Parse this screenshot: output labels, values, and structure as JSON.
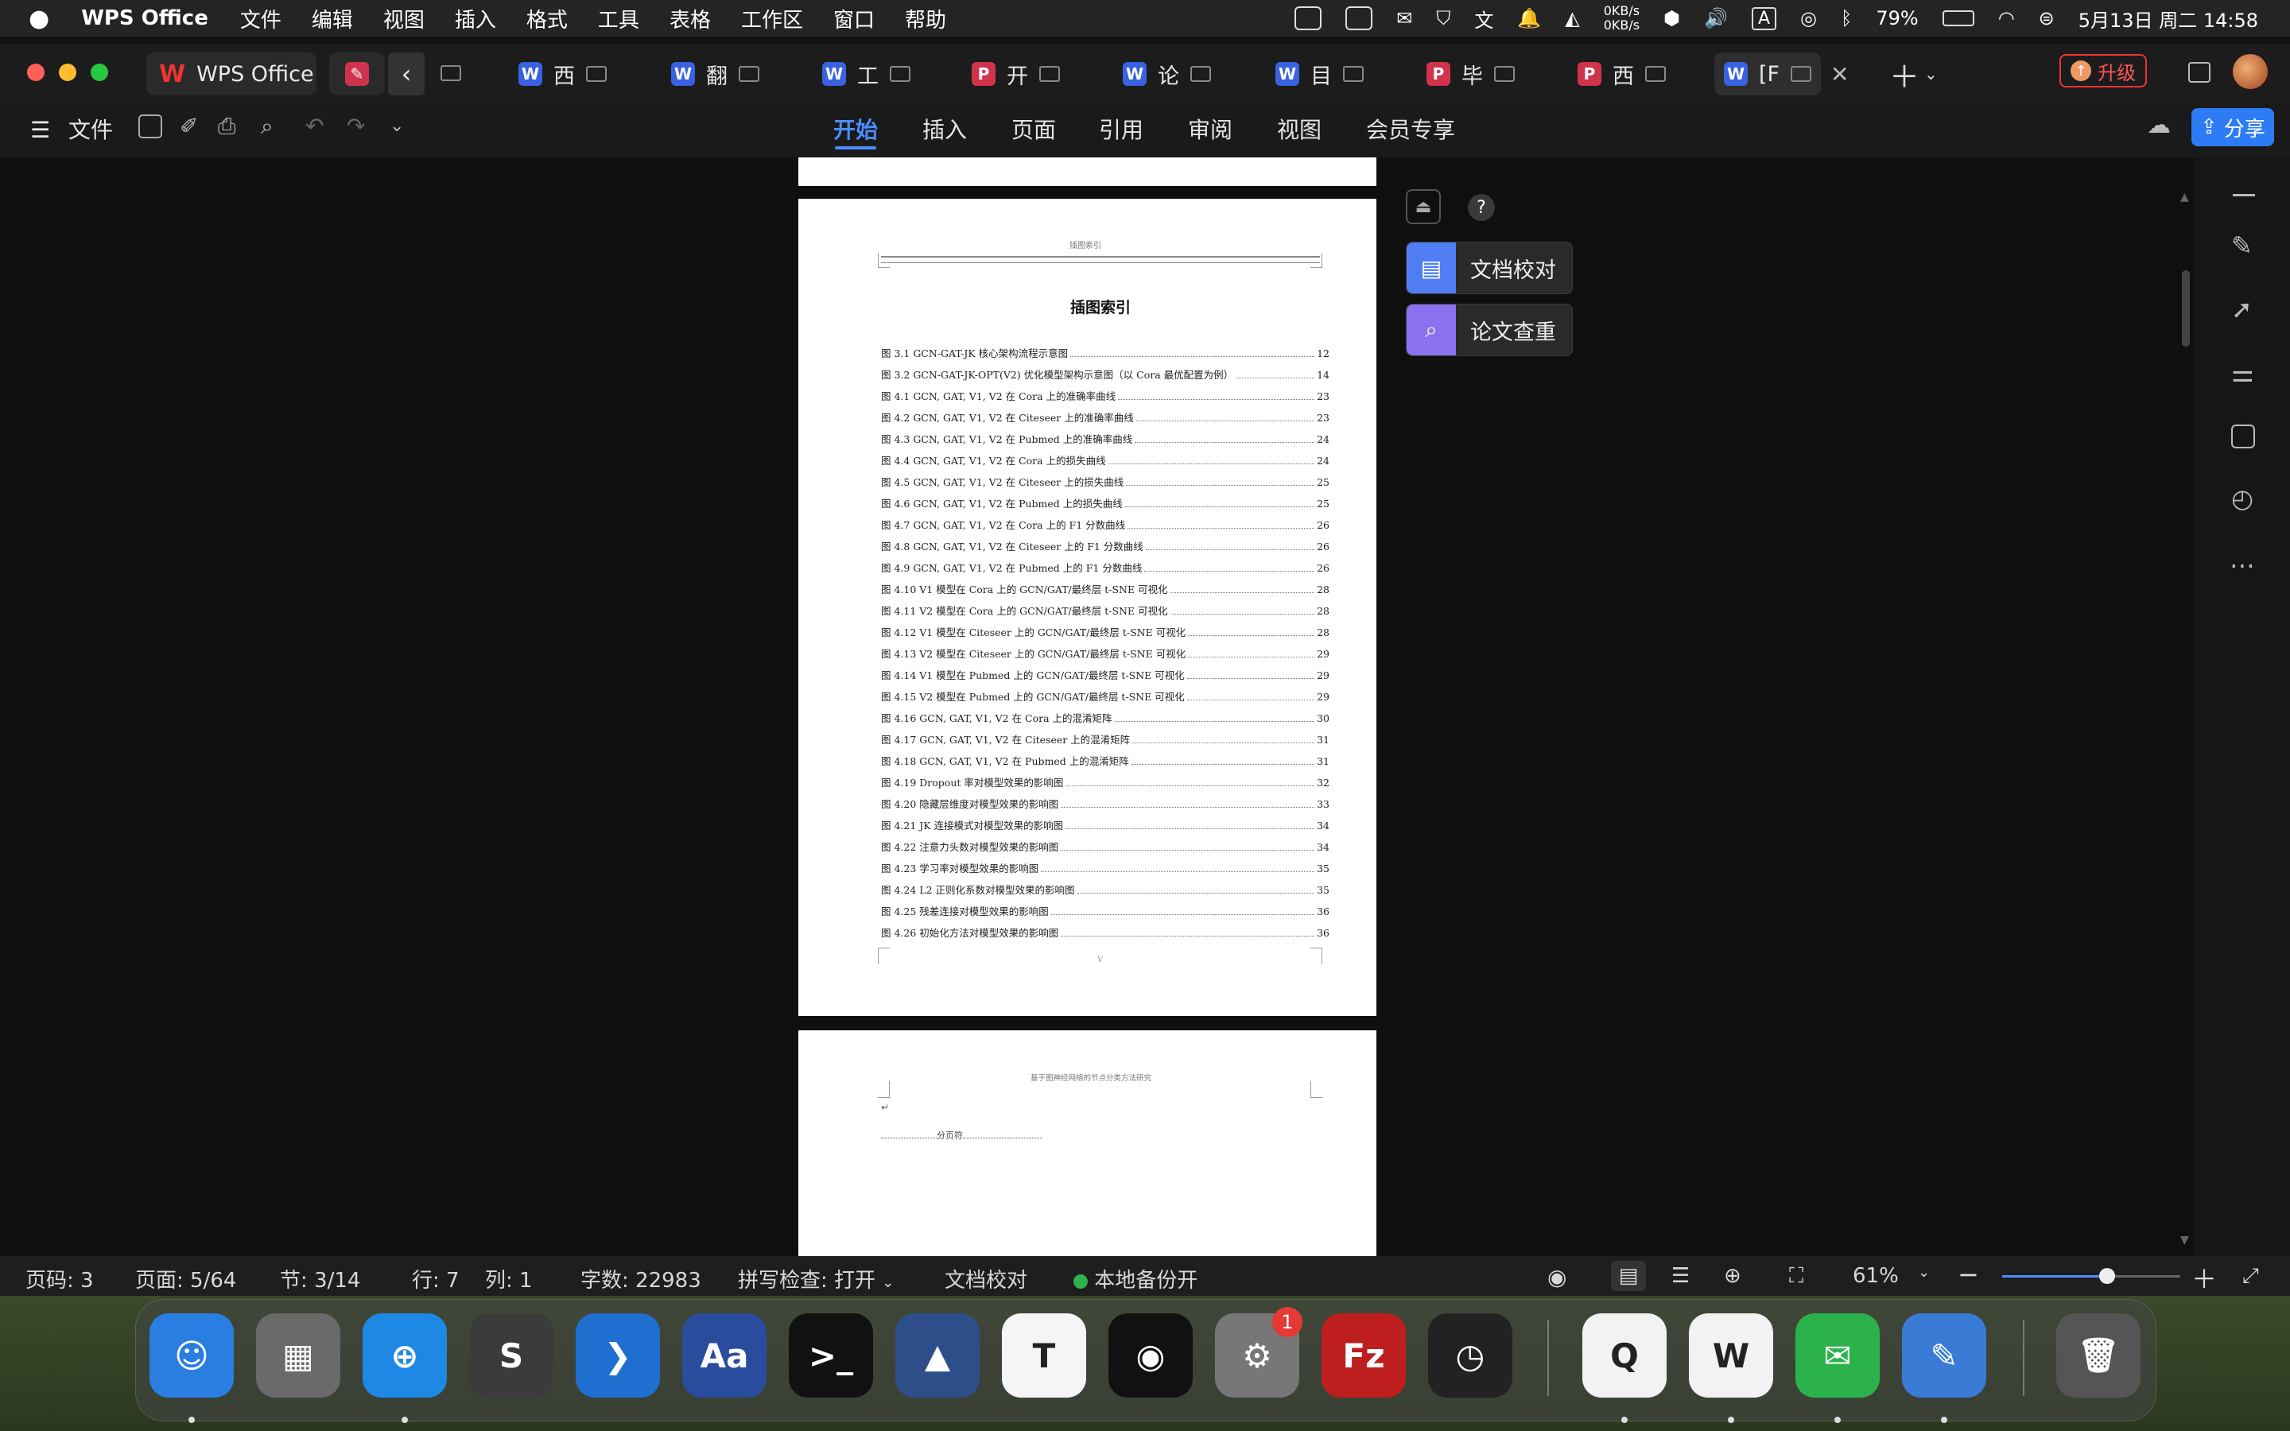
{
  "menubar": {
    "app": "WPS Office",
    "items": [
      "文件",
      "编辑",
      "视图",
      "插入",
      "格式",
      "工具",
      "表格",
      "工作区",
      "窗口",
      "帮助"
    ],
    "net_up": "0KB/s",
    "net_down": "0KB/s",
    "input_method": "A",
    "battery": "79%",
    "datetime": "5月13日 周二  14:58"
  },
  "tabs": {
    "home": "WPS Office",
    "docs": [
      {
        "label": "西",
        "icon": "W",
        "color": "#3a62e0"
      },
      {
        "label": "翻",
        "icon": "W",
        "color": "#3a62e0"
      },
      {
        "label": "工",
        "icon": "W",
        "color": "#3a62e0"
      },
      {
        "label": "开",
        "icon": "P",
        "color": "#d0344c"
      },
      {
        "label": "论",
        "icon": "W",
        "color": "#3a62e0"
      },
      {
        "label": "目",
        "icon": "W",
        "color": "#3a62e0"
      },
      {
        "label": "毕",
        "icon": "P",
        "color": "#d0344c"
      },
      {
        "label": "西",
        "icon": "P",
        "color": "#d0344c"
      },
      {
        "label": "[F",
        "icon": "W",
        "color": "#3a62e0"
      }
    ],
    "upgrade": "升级"
  },
  "toolbar": {
    "file": "文件",
    "nav": [
      "开始",
      "插入",
      "页面",
      "引用",
      "审阅",
      "视图",
      "会员专享"
    ],
    "share": "分享"
  },
  "panel": {
    "proofread": "文档校对",
    "plagiarism": "论文查重",
    "help": "?"
  },
  "doc": {
    "header_page1": "插图索引",
    "title": "插图索引",
    "footer_page": "V",
    "header_page2": "基于图神经网络的节点分类方法研究",
    "section_break": "分页符",
    "toc": [
      {
        "label": "图 3.1   GCN-GAT-JK 核心架构流程示意图",
        "page": "12"
      },
      {
        "label": "图 3.2   GCN-GAT-JK-OPT(V2) 优化模型架构示意图（以 Cora 最优配置为例）",
        "page": "14"
      },
      {
        "label": "图 4.1   GCN, GAT, V1, V2 在 Cora 上的准确率曲线",
        "page": "23"
      },
      {
        "label": "图 4.2   GCN, GAT, V1, V2 在 Citeseer 上的准确率曲线",
        "page": "23"
      },
      {
        "label": "图 4.3   GCN, GAT, V1, V2 在 Pubmed 上的准确率曲线",
        "page": "24"
      },
      {
        "label": "图 4.4   GCN, GAT, V1, V2 在 Cora 上的损失曲线",
        "page": "24"
      },
      {
        "label": "图 4.5   GCN, GAT, V1, V2 在 Citeseer 上的损失曲线",
        "page": "25"
      },
      {
        "label": "图 4.6   GCN, GAT, V1, V2 在 Pubmed 上的损失曲线",
        "page": "25"
      },
      {
        "label": "图 4.7   GCN, GAT, V1, V2 在 Cora 上的 F1 分数曲线",
        "page": "26"
      },
      {
        "label": "图 4.8   GCN, GAT, V1, V2 在 Citeseer 上的 F1 分数曲线",
        "page": "26"
      },
      {
        "label": "图 4.9   GCN, GAT, V1, V2 在 Pubmed 上的 F1 分数曲线",
        "page": "26"
      },
      {
        "label": "图 4.10  V1 模型在 Cora 上的 GCN/GAT/最终层 t-SNE 可视化",
        "page": "28"
      },
      {
        "label": "图 4.11  V2 模型在 Cora 上的 GCN/GAT/最终层 t-SNE 可视化",
        "page": "28"
      },
      {
        "label": "图 4.12  V1 模型在 Citeseer 上的 GCN/GAT/最终层 t-SNE 可视化",
        "page": "28"
      },
      {
        "label": "图 4.13  V2 模型在 Citeseer 上的 GCN/GAT/最终层 t-SNE 可视化",
        "page": "29"
      },
      {
        "label": "图 4.14  V1 模型在 Pubmed 上的 GCN/GAT/最终层 t-SNE 可视化",
        "page": "29"
      },
      {
        "label": "图 4.15  V2 模型在 Pubmed 上的 GCN/GAT/最终层 t-SNE 可视化",
        "page": "29"
      },
      {
        "label": "图 4.16  GCN, GAT, V1, V2 在 Cora 上的混淆矩阵",
        "page": "30"
      },
      {
        "label": "图 4.17  GCN, GAT, V1, V2 在 Citeseer 上的混淆矩阵",
        "page": "31"
      },
      {
        "label": "图 4.18  GCN, GAT, V1, V2 在 Pubmed 上的混淆矩阵",
        "page": "31"
      },
      {
        "label": "图 4.19  Dropout 率对模型效果的影响图",
        "page": "32"
      },
      {
        "label": "图 4.20  隐藏层维度对模型效果的影响图",
        "page": "33"
      },
      {
        "label": "图 4.21  JK 连接模式对模型效果的影响图",
        "page": "34"
      },
      {
        "label": "图 4.22  注意力头数对模型效果的影响图",
        "page": "34"
      },
      {
        "label": "图 4.23  学习率对模型效果的影响图",
        "page": "35"
      },
      {
        "label": "图 4.24  L2 正则化系数对模型效果的影响图",
        "page": "35"
      },
      {
        "label": "图 4.25  残差连接对模型效果的影响图",
        "page": "36"
      },
      {
        "label": "图 4.26  初始化方法对模型效果的影响图",
        "page": "36"
      }
    ]
  },
  "status": {
    "page_code": "页码: 3",
    "pages": "页面: 5/64",
    "section": "节: 3/14",
    "row": "行: 7",
    "col": "列: 1",
    "words": "字数: 22983",
    "spell": "拼写检查: 打开",
    "proof": "文档校对",
    "backup": "本地备份开",
    "zoom": "61%",
    "zoom_slider_fraction": 0.59
  },
  "dock": {
    "apps": [
      {
        "name": "finder",
        "glyph": "☺",
        "color": "#2a7de1"
      },
      {
        "name": "launchpad",
        "glyph": "▦",
        "color": "#6a6a6a"
      },
      {
        "name": "safari",
        "glyph": "⊕",
        "color": "#1e88e5"
      },
      {
        "name": "sublime-text",
        "glyph": "S",
        "color": "#3b3b3b"
      },
      {
        "name": "vscode",
        "glyph": "❯",
        "color": "#1f6fd1"
      },
      {
        "name": "dictionary",
        "glyph": "Aa",
        "color": "#2a4c9c"
      },
      {
        "name": "terminal",
        "glyph": ">_",
        "color": "#111"
      },
      {
        "name": "matlab",
        "glyph": "▲",
        "color": "#2e4e8a"
      },
      {
        "name": "typora",
        "glyph": "T",
        "color": "#f5f5f5"
      },
      {
        "name": "chatbot",
        "glyph": "◉",
        "color": "#111"
      },
      {
        "name": "system-settings",
        "glyph": "⚙",
        "color": "#777"
      },
      {
        "name": "filezilla",
        "glyph": "Fz",
        "color": "#bf1e1e"
      },
      {
        "name": "clock",
        "glyph": "◷",
        "color": "#222"
      },
      {
        "name": "qq",
        "glyph": "Q",
        "color": "#f2f2f2"
      },
      {
        "name": "wps",
        "glyph": "W",
        "color": "#f2f2f2"
      },
      {
        "name": "wechat",
        "glyph": "✉",
        "color": "#2bb24c"
      },
      {
        "name": "preview",
        "glyph": "✎",
        "color": "#3a7bd5"
      },
      {
        "name": "trash",
        "glyph": "🗑",
        "color": "#555"
      }
    ],
    "settings_badge": "1"
  }
}
